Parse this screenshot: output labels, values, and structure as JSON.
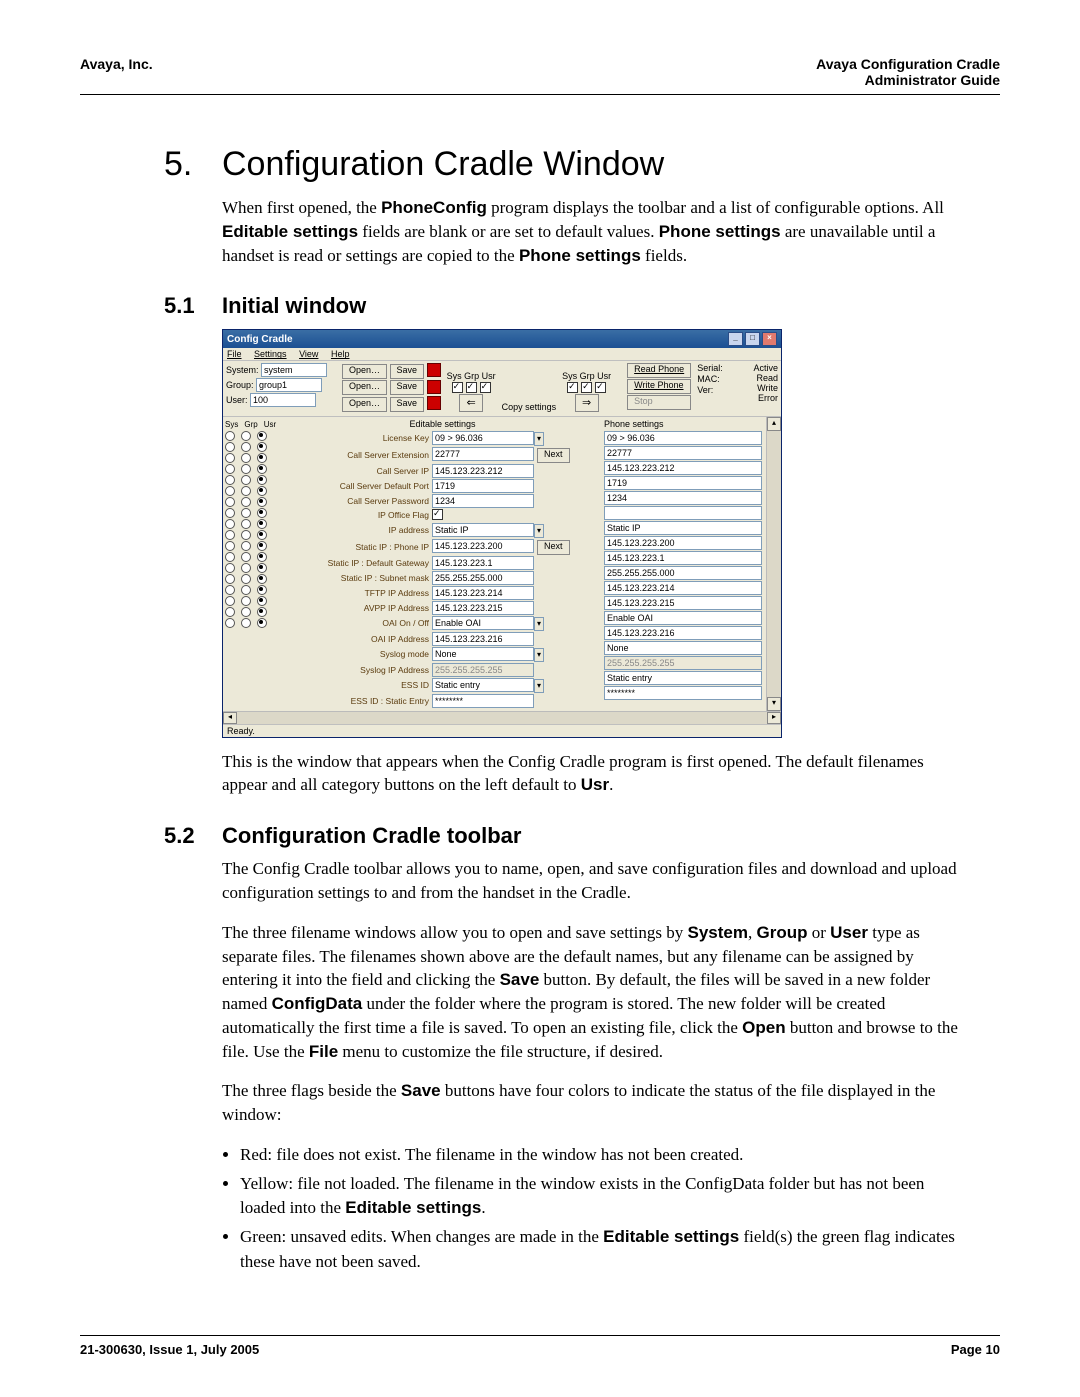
{
  "header": {
    "left": "Avaya, Inc.",
    "right1": "Avaya Configuration Cradle",
    "right2": "Administrator Guide"
  },
  "footer": {
    "left": "21-300630, Issue 1, July 2005",
    "right": "Page 10"
  },
  "chapter": {
    "num": "5.",
    "title": "Configuration Cradle Window"
  },
  "intro": {
    "p1a": "When first opened, the ",
    "p1b": "PhoneConfig",
    "p1c": " program displays the toolbar and a list of configurable options. All ",
    "p1d": "Editable settings",
    "p1e": " fields are blank or are set to default values. ",
    "p1f": "Phone settings",
    "p1g": " are unavailable until a handset is read or settings are copied to the ",
    "p1h": "Phone settings",
    "p1i": " fields."
  },
  "sec51": {
    "num": "5.1",
    "title": "Initial window"
  },
  "sec51_after": {
    "p1a": "This is the window that appears when the Config Cradle program is first opened. The default filenames appear and all category buttons on the left default to ",
    "p1b": "Usr",
    "p1c": "."
  },
  "sec52": {
    "num": "5.2",
    "title": "Configuration Cradle toolbar"
  },
  "sec52_body": {
    "p1": "The Config Cradle toolbar allows you to name, open, and save configuration files and download and upload configuration settings to and from the handset in the Cradle.",
    "p2a": "The three filename windows allow you to open and save settings by ",
    "p2b": "System",
    "p2c": ", ",
    "p2d": "Group",
    "p2e": " or ",
    "p2f": "User",
    "p2g": " type as separate files. The filenames shown above are the default names, but any filename can be assigned by entering it into the field and clicking the ",
    "p2h": "Save",
    "p2i": " button. By default, the files will be saved in a new folder named ",
    "p2j": "ConfigData",
    "p2k": " under the folder where the program is stored. The new folder will be created automatically the first time a file is saved. To open an existing file, click the ",
    "p2l": "Open",
    "p2m": " button and browse to the file. Use the ",
    "p2n": "File",
    "p2o": " menu to customize the file structure, if desired.",
    "p3a": "The three flags beside the ",
    "p3b": "Save",
    "p3c": " buttons have four colors to indicate the status of the file displayed in the window:",
    "b1": "Red: file does not exist. The filename in the window has not been created.",
    "b2a": "Yellow: file not loaded. The filename in the window exists in the ConfigData folder but has not been loaded into the ",
    "b2b": "Editable settings",
    "b2c": ".",
    "b3a": "Green: unsaved edits. When changes are made in the ",
    "b3b": "Editable settings",
    "b3c": " field(s) the green flag indicates these have not been saved."
  },
  "shot": {
    "title": "Config Cradle",
    "menu": {
      "file": "File",
      "settings": "Settings",
      "view": "View",
      "help": "Help"
    },
    "toolbar": {
      "labels": {
        "system": "System:",
        "group": "Group:",
        "user": "User:"
      },
      "values": {
        "system": "system",
        "group": "group1",
        "user": "100"
      },
      "open": "Open…",
      "save": "Save",
      "sgu1": "Sys Grp Usr",
      "sgu2": "Sys Grp Usr",
      "copy_settings": "Copy settings",
      "read_phone": "Read Phone",
      "write_phone": "Write Phone",
      "stop": "Stop",
      "serial": "Serial:",
      "mac": "MAC:",
      "ver": "Ver:",
      "status": {
        "active": "Active",
        "read": "Read",
        "write": "Write",
        "error": "Error"
      }
    },
    "radio_hdr": {
      "sys": "Sys",
      "grp": "Grp",
      "usr": "Usr"
    },
    "editable_head": "Editable settings",
    "phone_head": "Phone settings",
    "next": "Next",
    "rows": [
      {
        "label": "License Key",
        "val": "09 > 96.036",
        "phone": "09 > 96.036",
        "dropdown": true
      },
      {
        "label": "Call Server Extension",
        "val": "22777",
        "phone": "22777",
        "next": true
      },
      {
        "label": "Call Server IP",
        "val": "145.123.223.212",
        "phone": "145.123.223.212"
      },
      {
        "label": "Call Server Default Port",
        "val": "1719",
        "phone": "1719"
      },
      {
        "label": "Call Server Password",
        "val": "1234",
        "phone": "1234"
      },
      {
        "label": "IP Office Flag",
        "val": "",
        "phone": "",
        "checkbox": true
      },
      {
        "label": "IP address",
        "val": "Static IP",
        "phone": "Static IP",
        "dropdown": true
      },
      {
        "label": "Static IP : Phone IP",
        "val": "145.123.223.200",
        "phone": "145.123.223.200",
        "next": true
      },
      {
        "label": "Static IP : Default Gateway",
        "val": "145.123.223.1",
        "phone": "145.123.223.1"
      },
      {
        "label": "Static IP : Subnet mask",
        "val": "255.255.255.000",
        "phone": "255.255.255.000"
      },
      {
        "label": "TFTP IP Address",
        "val": "145.123.223.214",
        "phone": "145.123.223.214"
      },
      {
        "label": "AVPP IP Address",
        "val": "145.123.223.215",
        "phone": "145.123.223.215"
      },
      {
        "label": "OAI On / Off",
        "val": "Enable OAI",
        "phone": "Enable OAI",
        "dropdown": true
      },
      {
        "label": "OAI IP Address",
        "val": "145.123.223.216",
        "phone": "145.123.223.216"
      },
      {
        "label": "Syslog mode",
        "val": "None",
        "phone": "None",
        "dropdown": true
      },
      {
        "label": "Syslog IP Address",
        "val": "255.255.255.255",
        "phone": "255.255.255.255",
        "gray": true
      },
      {
        "label": "ESS ID",
        "val": "Static entry",
        "phone": "Static entry",
        "dropdown": true
      },
      {
        "label": "ESS ID : Static Entry",
        "val": "********",
        "phone": "********"
      }
    ],
    "status": "Ready."
  }
}
